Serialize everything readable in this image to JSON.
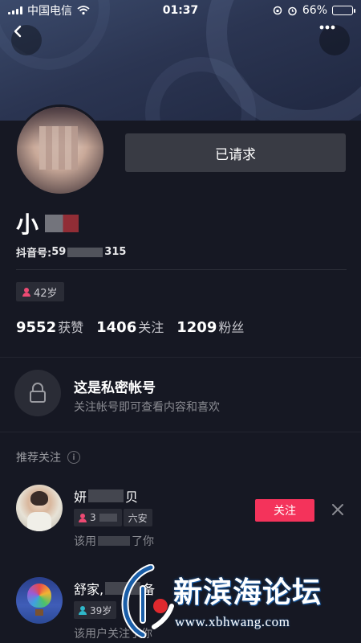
{
  "status_bar": {
    "carrier": "中国电信",
    "time": "01:37",
    "battery": "66%",
    "battery_level": 0.66
  },
  "header": {
    "back_icon": "chevron-left-icon",
    "more_icon": "more-dots-icon"
  },
  "profile": {
    "requested_label": "已请求",
    "nickname_visible": "小",
    "douyin_id_label": "抖音号: ",
    "douyin_id_prefix": "59",
    "douyin_id_suffix": "315",
    "age_tag": "42岁",
    "stats": [
      {
        "num": "9552",
        "label": "获赞"
      },
      {
        "num": "1406",
        "label": "关注"
      },
      {
        "num": "1209",
        "label": "粉丝"
      }
    ]
  },
  "private": {
    "title": "这是私密帐号",
    "subtitle": "关注帐号即可查看内容和喜欢"
  },
  "recommend": {
    "header": "推荐关注",
    "info_icon": "i",
    "items": [
      {
        "name_start": "妍",
        "name_end": "贝",
        "age_tag": "3",
        "location_tag": "六安",
        "reason_start": "该用",
        "reason_end": "了你",
        "follow_label": "关注"
      },
      {
        "name_start": "舒家,",
        "name_end": "备",
        "age_tag": "39岁",
        "reason": "该用户关注了你"
      }
    ]
  },
  "watermark": {
    "text": "新滨海论坛",
    "url": "www.xbhwang.com"
  },
  "colors": {
    "background": "#161823",
    "follow_red": "#f4335b",
    "female_pink": "#ee4a73",
    "male_blue": "#2fb8ca"
  }
}
